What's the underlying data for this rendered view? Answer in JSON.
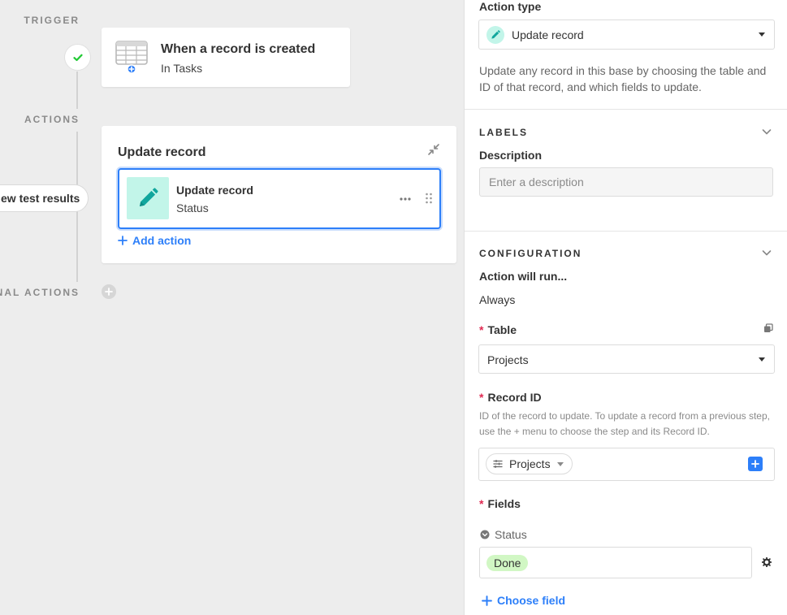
{
  "canvas": {
    "trigger_label": "TRIGGER",
    "actions_label": "ACTIONS",
    "conditional_label": "ONAL ACTIONS",
    "trigger_card": {
      "title": "When a record is created",
      "subtitle": "In Tasks",
      "icon": "table-icon"
    },
    "actions_card": {
      "title": "Update record",
      "action_item": {
        "title": "Update record",
        "subtitle": "Status",
        "icon": "pencil-icon"
      },
      "add_action_label": "Add action"
    },
    "test_results_button": "ew test results"
  },
  "panel": {
    "action_type_label": "Action type",
    "action_type_value": "Update record",
    "description_text": "Update any record in this base by choosing the table and ID of that record, and which fields to update.",
    "labels_section": {
      "heading": "LABELS",
      "description_label": "Description",
      "description_placeholder": "Enter a description"
    },
    "configuration_section": {
      "heading": "CONFIGURATION",
      "run_label": "Action will run...",
      "run_value": "Always",
      "table_label": "Table",
      "table_value": "Projects",
      "record_id_label": "Record ID",
      "record_id_help": "ID of the record to update. To update a record from a previous step, use the + menu to choose the step and its Record ID.",
      "record_id_token": "Projects",
      "fields_label": "Fields",
      "field_name": "Status",
      "field_value": "Done",
      "choose_field_label": "Choose field"
    }
  },
  "colors": {
    "accent_blue": "#2d7ff9",
    "teal": "#11a69d",
    "teal_bg": "#c2f5e9",
    "required_red": "#e02a52",
    "done_green": "#d1f7c4"
  }
}
